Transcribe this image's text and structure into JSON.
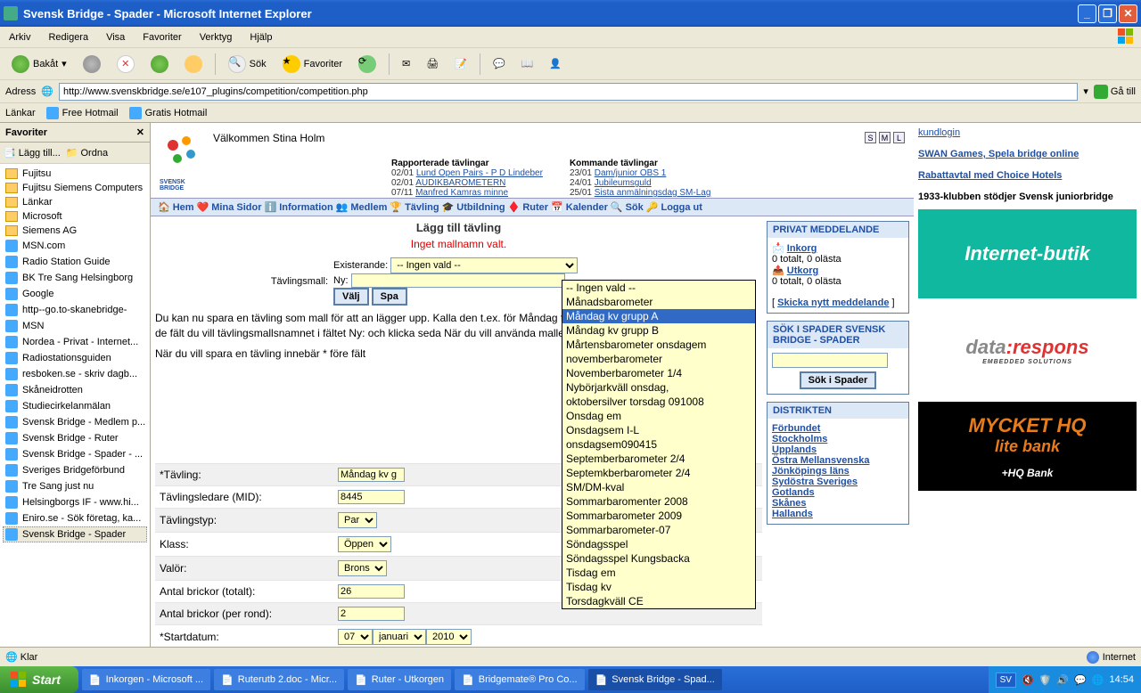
{
  "window": {
    "title": "Svensk Bridge - Spader - Microsoft Internet Explorer"
  },
  "menubar": [
    "Arkiv",
    "Redigera",
    "Visa",
    "Favoriter",
    "Verktyg",
    "Hjälp"
  ],
  "toolbar": {
    "back": "Bakåt",
    "search": "Sök",
    "favorites": "Favoriter"
  },
  "addressbar": {
    "label": "Adress",
    "url": "http://www.svenskbridge.se/e107_plugins/competition/competition.php",
    "go": "Gå till"
  },
  "linksbar": {
    "label": "Länkar",
    "items": [
      "Free Hotmail",
      "Gratis Hotmail"
    ]
  },
  "favorites_panel": {
    "title": "Favoriter",
    "add": "Lägg till...",
    "organize": "Ordna",
    "items": [
      {
        "type": "folder",
        "label": "Fujitsu"
      },
      {
        "type": "folder",
        "label": "Fujitsu Siemens Computers"
      },
      {
        "type": "folder",
        "label": "Länkar"
      },
      {
        "type": "folder",
        "label": "Microsoft"
      },
      {
        "type": "folder",
        "label": "Siemens AG"
      },
      {
        "type": "page",
        "label": "MSN.com"
      },
      {
        "type": "page",
        "label": "Radio Station Guide"
      },
      {
        "type": "page",
        "label": "BK Tre Sang Helsingborg"
      },
      {
        "type": "page",
        "label": "Google"
      },
      {
        "type": "page",
        "label": "http--go.to-skanebridge-"
      },
      {
        "type": "page",
        "label": "MSN"
      },
      {
        "type": "page",
        "label": "Nordea - Privat - Internet..."
      },
      {
        "type": "page",
        "label": "Radiostationsguiden"
      },
      {
        "type": "page",
        "label": "resboken.se - skriv dagb..."
      },
      {
        "type": "page",
        "label": "Skåneidrotten"
      },
      {
        "type": "page",
        "label": "Studiecirkelanmälan"
      },
      {
        "type": "page",
        "label": "Svensk Bridge - Medlem p..."
      },
      {
        "type": "page",
        "label": "Svensk Bridge - Ruter"
      },
      {
        "type": "page",
        "label": "Svensk Bridge - Spader - ..."
      },
      {
        "type": "page",
        "label": "Sveriges Bridgeförbund"
      },
      {
        "type": "page",
        "label": "Tre Sang just nu"
      },
      {
        "type": "page",
        "label": "Helsingborgs IF - www.hi..."
      },
      {
        "type": "page",
        "label": "Eniro.se - Sök företag, ka..."
      },
      {
        "type": "page",
        "label": "Svensk Bridge - Spader",
        "selected": true
      }
    ]
  },
  "site": {
    "logo": "SVENSK BRIDGE",
    "welcome": "Välkommen Stina Holm",
    "sizes": [
      "S",
      "M",
      "L"
    ],
    "reported": {
      "heading": "Rapporterade tävlingar",
      "rows": [
        {
          "date": "02/01",
          "text": "Lund Open Pairs - P D Lindeber"
        },
        {
          "date": "02/01",
          "text": "AUDIKBAROMETERN"
        },
        {
          "date": "07/11",
          "text": "Manfred Kamras minne"
        }
      ]
    },
    "upcoming": {
      "heading": "Kommande tävlingar",
      "rows": [
        {
          "date": "23/01",
          "text": "Dam/junior OBS 1"
        },
        {
          "date": "24/01",
          "text": "Jubileumsguld"
        },
        {
          "date": "25/01",
          "text": "Sista anmälningsdag SM-Lag"
        }
      ]
    },
    "nav": [
      "Hem",
      "Mina Sidor",
      "Information",
      "Medlem",
      "Tävling",
      "Utbildning",
      "Ruter",
      "Kalender",
      "Sök",
      "Logga ut"
    ]
  },
  "form": {
    "heading": "Lägg till tävling",
    "error": "Inget mallnamn valt.",
    "template_label": "Tävlingsmall:",
    "existing_label": "Existerande:",
    "existing_value": "-- Ingen vald --",
    "new_label": "Ny:",
    "new_value": "",
    "btn_choose": "Välj",
    "btn_save": "Spa",
    "dropdown": {
      "options": [
        "-- Ingen vald --",
        "Månadsbarometer",
        "Måndag kv grupp A",
        "Måndag kv grupp B",
        "Mårtensbarometer onsdagem",
        "novemberbarometer",
        "Novemberbarometer 1/4",
        "Nybörjarkväll onsdag,",
        "oktobersilver torsdag 091008",
        "Onsdag em",
        "Onsdagsem I-L",
        "onsdagsem090415",
        "Septemberbarometer 2/4",
        "Septemkberbarometer 2/4",
        "SM/DM-kval",
        "Sommarbaromenter 2008",
        "Sommarbarometer 2009",
        "Sommarbarometer-07",
        "Söndagsspel",
        "Söndagsspel Kungsbacka",
        "Tisdag em",
        "Tisdag kv",
        "Torsdagkväll CE"
      ],
      "highlighted_index": 2
    },
    "paragraph1": "Du kan nu spara en tävling som mall för att an lägger upp. Kalla den t.ex. för Måndag fm, Dag att du lätt känner igen den. Fyll i de fält du vill tävlingsmallsnamnet i fältet Ny: och klicka seda När du vill använda mallen väljer du den i lista",
    "paragraph2": "När du vill spara en tävling innebär * före fält",
    "rows": {
      "tavling": {
        "label": "*Tävling:",
        "value": "Måndag kv g"
      },
      "ledare": {
        "label": "Tävlingsledare (MID):",
        "value": "8445"
      },
      "typ": {
        "label": "Tävlingstyp:",
        "value": "Par"
      },
      "klass": {
        "label": "Klass:",
        "value": "Öppen"
      },
      "valor": {
        "label": "Valör:",
        "value": "Brons"
      },
      "brickor_total": {
        "label": "Antal brickor (totalt):",
        "value": "26"
      },
      "brickor_rond": {
        "label": "Antal brickor (per rond):",
        "value": "2"
      },
      "startdatum": {
        "label": "*Startdatum:",
        "day": "07",
        "month": "januari",
        "year": "2010"
      }
    }
  },
  "sidebar": {
    "pm": {
      "title": "PRIVAT MEDDELANDE",
      "inbox": "Inkorg",
      "inbox_status": "0 totalt, 0 olästa",
      "outbox": "Utkorg",
      "outbox_status": "0 totalt, 0 olästa",
      "send": "Skicka nytt meddelande"
    },
    "search": {
      "title": "SÖK I SPADER SVENSK BRIDGE - SPADER",
      "button": "Sök i Spader"
    },
    "districts": {
      "title": "DISTRIKTEN",
      "items": [
        "Förbundet",
        "Stockholms",
        "Upplands",
        "Östra Mellansvenska",
        "Jönköpings läns",
        "Sydöstra Sveriges",
        "Gotlands",
        "Skånes",
        "Hallands"
      ]
    }
  },
  "right_col": {
    "login": "kundlogin",
    "links": [
      "SWAN Games, Spela bridge online",
      "Rabattavtal med Choice Hotels",
      "1933-klubben stödjer Svensk juniorbridge"
    ],
    "ad1": "Internet-butik",
    "ad2": {
      "a": "data",
      "b": "respons",
      "sub": "EMBEDDED SOLUTIONS"
    },
    "ad3": {
      "a": "MYCKET HQ",
      "b": "lite bank",
      "c": "+HQ Bank"
    }
  },
  "statusbar": {
    "status": "Klar",
    "zone": "Internet"
  },
  "taskbar": {
    "start": "Start",
    "items": [
      "Inkorgen - Microsoft ...",
      "Ruterutb 2.doc - Micr...",
      "Ruter - Utkorgen",
      "Bridgemate® Pro Co...",
      "Svensk Bridge - Spad..."
    ],
    "active_index": 4,
    "lang": "SV",
    "clock": "14:54"
  }
}
